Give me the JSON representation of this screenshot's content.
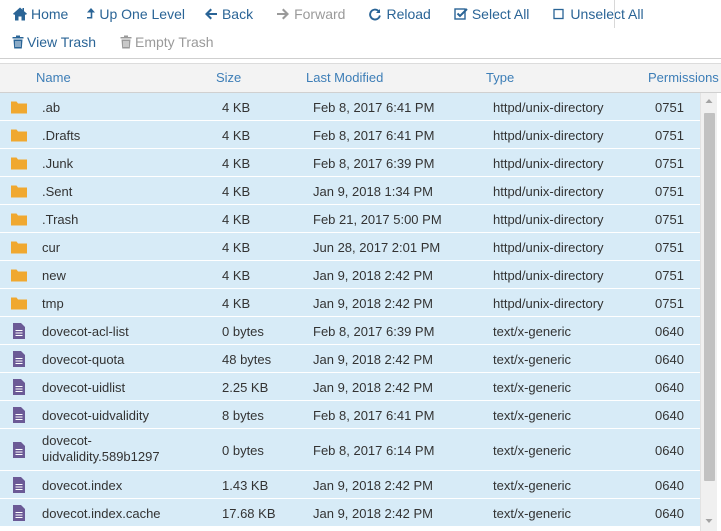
{
  "toolbar": {
    "home": "Home",
    "up_one_level": "Up One Level",
    "back": "Back",
    "forward": "Forward",
    "reload": "Reload",
    "select_all": "Select All",
    "unselect_all": "Unselect All",
    "view_trash": "View Trash",
    "empty_trash": "Empty Trash"
  },
  "columns": {
    "name": "Name",
    "size": "Size",
    "last_modified": "Last Modified",
    "type": "Type",
    "permissions": "Permissions"
  },
  "files": [
    {
      "name": ".ab",
      "size": "4 KB",
      "modified": "Feb 8, 2017 6:41 PM",
      "type": "httpd/unix-directory",
      "perm": "0751",
      "icon": "folder-icon"
    },
    {
      "name": ".Drafts",
      "size": "4 KB",
      "modified": "Feb 8, 2017 6:41 PM",
      "type": "httpd/unix-directory",
      "perm": "0751",
      "icon": "folder-icon"
    },
    {
      "name": ".Junk",
      "size": "4 KB",
      "modified": "Feb 8, 2017 6:39 PM",
      "type": "httpd/unix-directory",
      "perm": "0751",
      "icon": "folder-icon"
    },
    {
      "name": ".Sent",
      "size": "4 KB",
      "modified": "Jan 9, 2018 1:34 PM",
      "type": "httpd/unix-directory",
      "perm": "0751",
      "icon": "folder-icon"
    },
    {
      "name": ".Trash",
      "size": "4 KB",
      "modified": "Feb 21, 2017 5:00 PM",
      "type": "httpd/unix-directory",
      "perm": "0751",
      "icon": "folder-icon"
    },
    {
      "name": "cur",
      "size": "4 KB",
      "modified": "Jun 28, 2017 2:01 PM",
      "type": "httpd/unix-directory",
      "perm": "0751",
      "icon": "folder-icon"
    },
    {
      "name": "new",
      "size": "4 KB",
      "modified": "Jan 9, 2018 2:42 PM",
      "type": "httpd/unix-directory",
      "perm": "0751",
      "icon": "folder-icon"
    },
    {
      "name": "tmp",
      "size": "4 KB",
      "modified": "Jan 9, 2018 2:42 PM",
      "type": "httpd/unix-directory",
      "perm": "0751",
      "icon": "folder-icon"
    },
    {
      "name": "dovecot-acl-list",
      "size": "0 bytes",
      "modified": "Feb 8, 2017 6:39 PM",
      "type": "text/x-generic",
      "perm": "0640",
      "icon": "file-icon"
    },
    {
      "name": "dovecot-quota",
      "size": "48 bytes",
      "modified": "Jan 9, 2018 2:42 PM",
      "type": "text/x-generic",
      "perm": "0640",
      "icon": "file-icon"
    },
    {
      "name": "dovecot-uidlist",
      "size": "2.25 KB",
      "modified": "Jan 9, 2018 2:42 PM",
      "type": "text/x-generic",
      "perm": "0640",
      "icon": "file-icon"
    },
    {
      "name": "dovecot-uidvalidity",
      "size": "8 bytes",
      "modified": "Feb 8, 2017 6:41 PM",
      "type": "text/x-generic",
      "perm": "0640",
      "icon": "file-icon"
    },
    {
      "name": "dovecot-\nuidvalidity.589b1297",
      "size": "0 bytes",
      "modified": "Feb 8, 2017 6:14 PM",
      "type": "text/x-generic",
      "perm": "0640",
      "icon": "file-icon"
    },
    {
      "name": "dovecot.index",
      "size": "1.43 KB",
      "modified": "Jan 9, 2018 2:42 PM",
      "type": "text/x-generic",
      "perm": "0640",
      "icon": "file-icon"
    },
    {
      "name": "dovecot.index.cache",
      "size": "17.68 KB",
      "modified": "Jan 9, 2018 2:42 PM",
      "type": "text/x-generic",
      "perm": "0640",
      "icon": "file-icon"
    }
  ],
  "colors": {
    "link": "#2a6496",
    "header_text": "#3d7eb7",
    "row_bg": "#d7ebf7",
    "folder": "#f0a830",
    "file": "#6b5a96"
  }
}
